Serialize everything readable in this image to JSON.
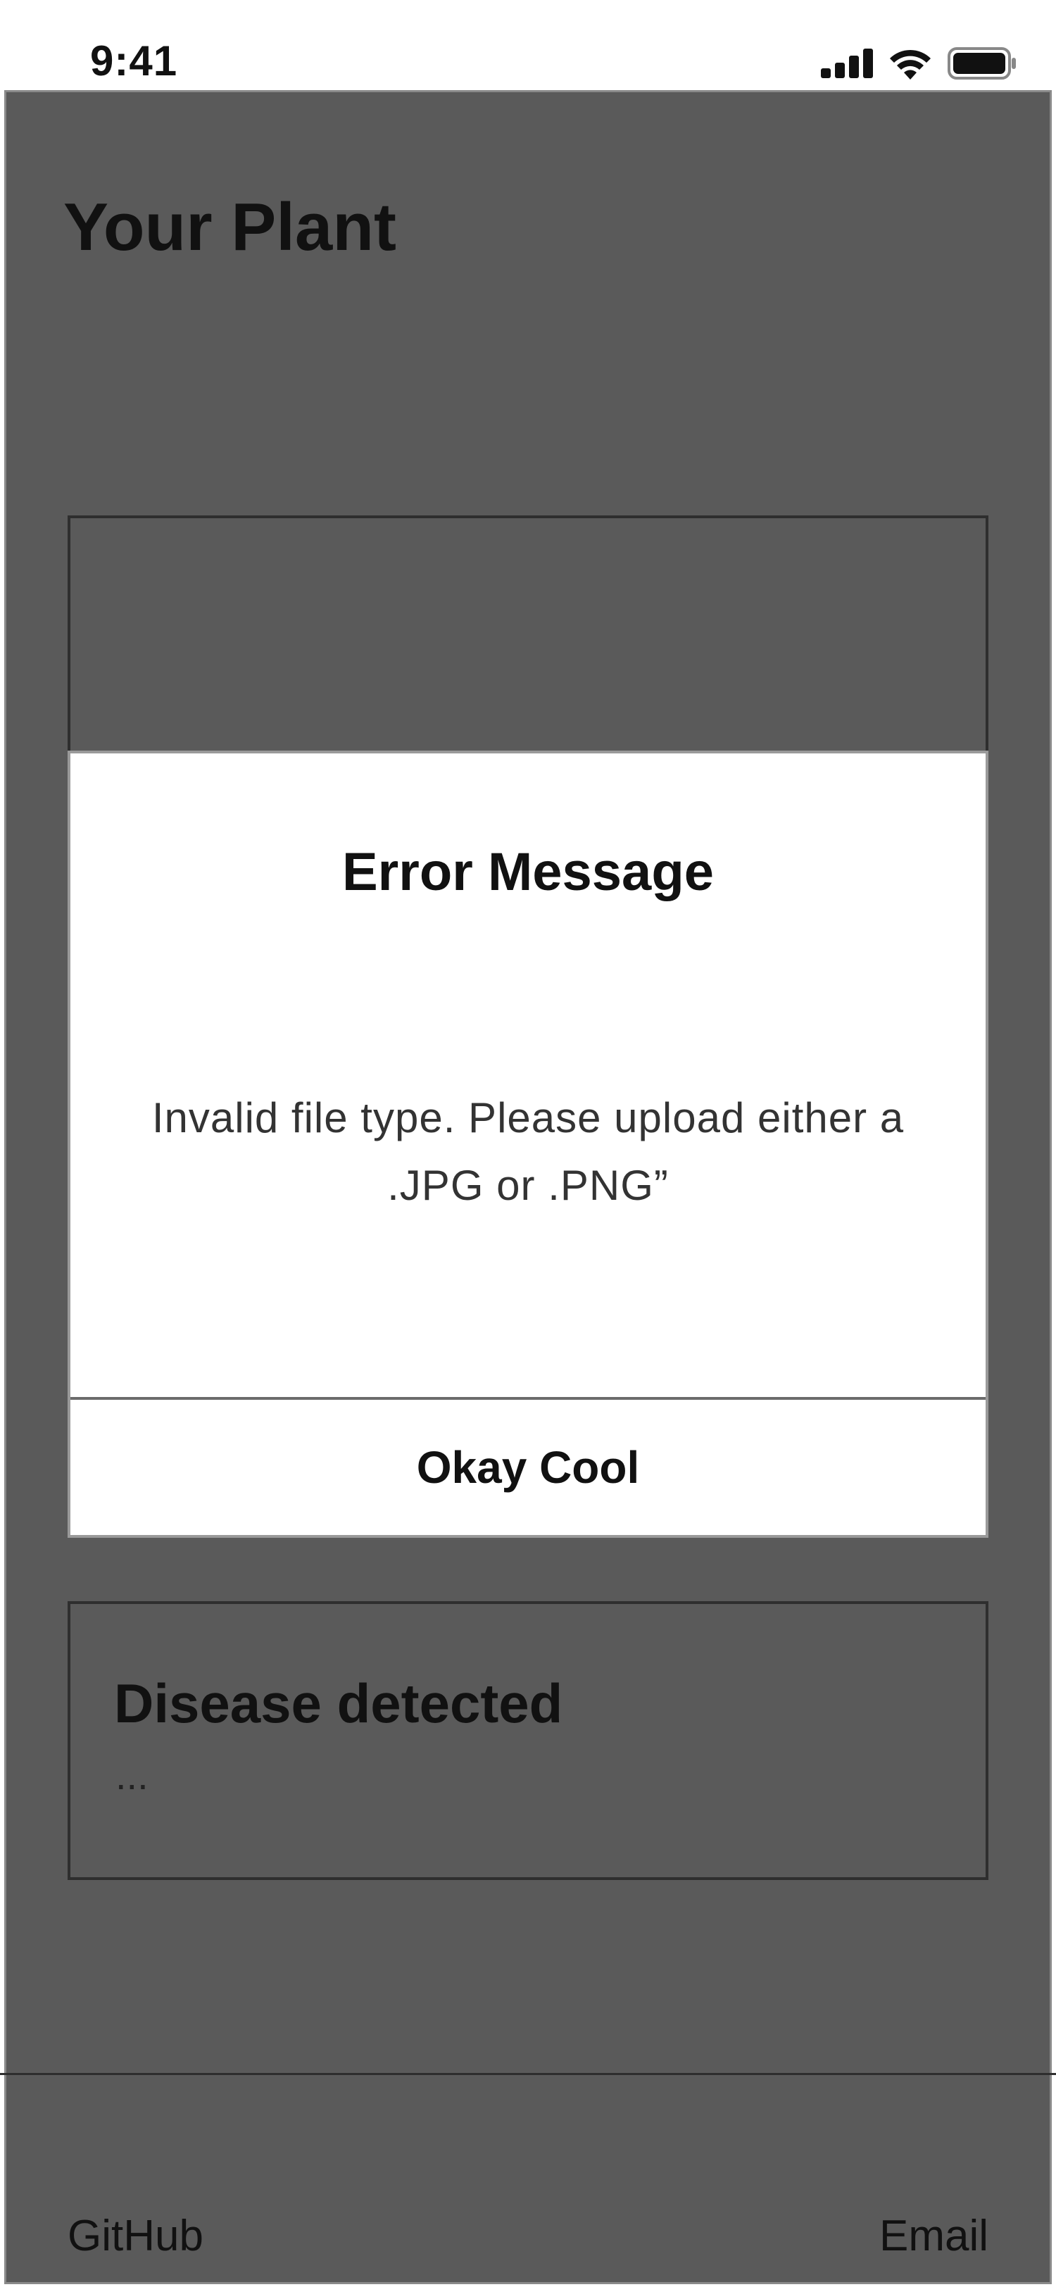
{
  "status_bar": {
    "time": "9:41",
    "icons": [
      "signal-icon",
      "wifi-icon",
      "battery-icon"
    ]
  },
  "page": {
    "title": "Your Plant"
  },
  "dialog": {
    "title": "Error Message",
    "message": "Invalid file type. Please upload either a .JPG or .PNG”",
    "button_label": "Okay Cool"
  },
  "result": {
    "title": "Disease detected",
    "body": "..."
  },
  "footer": {
    "github_label": "GitHub",
    "email_label": "Email"
  },
  "colors": {
    "overlay_bg": "#5a5a5a",
    "dialog_bg": "#ffffff",
    "text": "#111111"
  }
}
